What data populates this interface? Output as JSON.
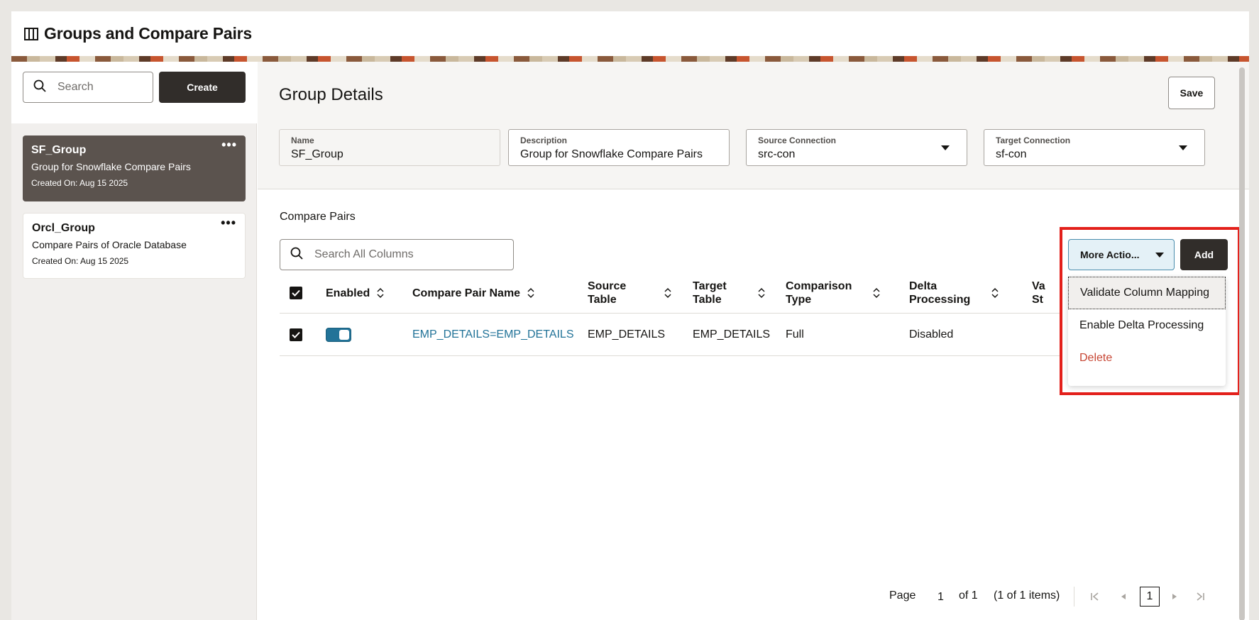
{
  "header": {
    "title": "Groups and Compare Pairs",
    "icon": "columns-icon"
  },
  "sidebar": {
    "search_placeholder": "Search",
    "create_label": "Create",
    "groups": [
      {
        "name": "SF_Group",
        "description": "Group for Snowflake Compare Pairs",
        "created": "Created On: Aug 15 2025",
        "menu": "•••"
      },
      {
        "name": "Orcl_Group",
        "description": "Compare Pairs of Oracle Database",
        "created": "Created On: Aug 15 2025",
        "menu": "•••"
      }
    ]
  },
  "details": {
    "title": "Group Details",
    "save_label": "Save",
    "fields": {
      "name": {
        "label": "Name",
        "value": "SF_Group"
      },
      "description": {
        "label": "Description",
        "value": "Group for Snowflake Compare Pairs"
      },
      "source": {
        "label": "Source Connection",
        "value": "src-con"
      },
      "target": {
        "label": "Target Connection",
        "value": "sf-con"
      }
    }
  },
  "compare_pairs": {
    "label": "Compare Pairs",
    "search_placeholder": "Search All Columns",
    "more_actions_label": "More Actio...",
    "add_label": "Add",
    "columns": {
      "enabled": "Enabled",
      "name": "Compare Pair Name",
      "source_1": "Source",
      "source_2": "Table",
      "target_1": "Target",
      "target_2": "Table",
      "comparison_1": "Comparison",
      "comparison_2": "Type",
      "delta_1": "Delta",
      "delta_2": "Processing",
      "partial_1": "Va",
      "partial_2": "St"
    },
    "rows": [
      {
        "name": "EMP_DETAILS=EMP_DETAILS",
        "source": "EMP_DETAILS",
        "target": "EMP_DETAILS",
        "comparison": "Full",
        "delta": "Disabled"
      }
    ],
    "menu_items": [
      "Validate Column Mapping",
      "Enable Delta Processing",
      "Delete"
    ]
  },
  "pagination": {
    "page_label": "Page",
    "page_value": "1",
    "of_label": "of 1",
    "items_label": "(1 of 1 items)",
    "current_page": "1"
  },
  "colors": {
    "accent": "#227398",
    "dark_button": "#312d2a",
    "danger": "#c74634",
    "highlight": "#e3201b"
  }
}
